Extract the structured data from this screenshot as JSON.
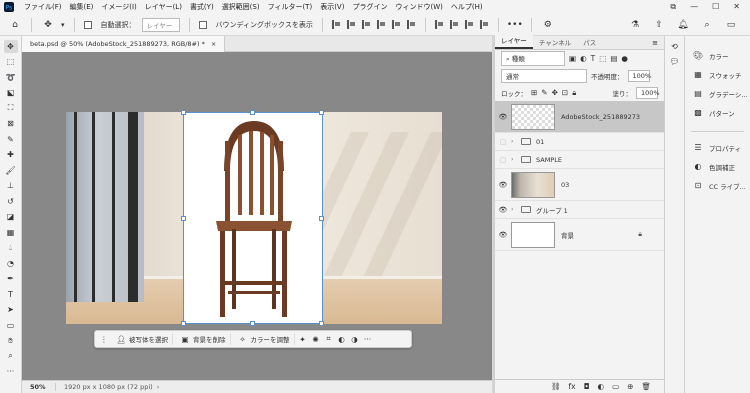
{
  "menubar": {
    "items": [
      "ファイル(F)",
      "編集(E)",
      "イメージ(I)",
      "レイヤー(L)",
      "書式(Y)",
      "選択範囲(S)",
      "フィルター(T)",
      "表示(V)",
      "プラグイン",
      "ウィンドウ(W)",
      "ヘルプ(H)"
    ]
  },
  "options": {
    "auto_select_label": "自動選択：",
    "auto_select_value": "レイヤー",
    "bounding_box_label": "バウンディングボックスを表示"
  },
  "document": {
    "tab_title": "beta.psd @ 50% (AdobeStock_251889273, RGB/8#) *",
    "close": "×"
  },
  "context_bar": {
    "select_subject": "被写体を選択",
    "remove_background": "背景を削除",
    "adjust_color": "カラーを調整",
    "more": "···"
  },
  "status": {
    "zoom": "50%",
    "dimensions": "1920 px x 1080 px (72 ppi)"
  },
  "layers_panel": {
    "tabs": [
      "レイヤー",
      "チャンネル",
      "パス"
    ],
    "filter_kind": "種類",
    "blend_mode": "通常",
    "opacity_label": "不透明度：",
    "opacity_value": "100%",
    "lock_label": "ロック：",
    "fill_label": "塗り：",
    "fill_value": "100%",
    "layers": [
      {
        "name": "AdobeStock_251889273",
        "visible": true,
        "selected": true
      },
      {
        "name": "01",
        "visible": false,
        "group": true
      },
      {
        "name": "SAMPLE",
        "visible": false,
        "group": true
      },
      {
        "name": "03",
        "visible": true
      },
      {
        "name": "グループ 1",
        "visible": true,
        "group": true
      },
      {
        "name": "背景",
        "visible": true,
        "locked": true
      }
    ]
  },
  "right_panel": {
    "items": [
      "カラー",
      "スウォッチ",
      "グラデーシ...",
      "パターン",
      "プロパティ",
      "色調補正",
      "CC ライブ..."
    ]
  },
  "colors": {
    "canvas_bg": "#888888",
    "selection_blue": "#5a8fd0",
    "panel_bg": "#f3f3f3"
  }
}
